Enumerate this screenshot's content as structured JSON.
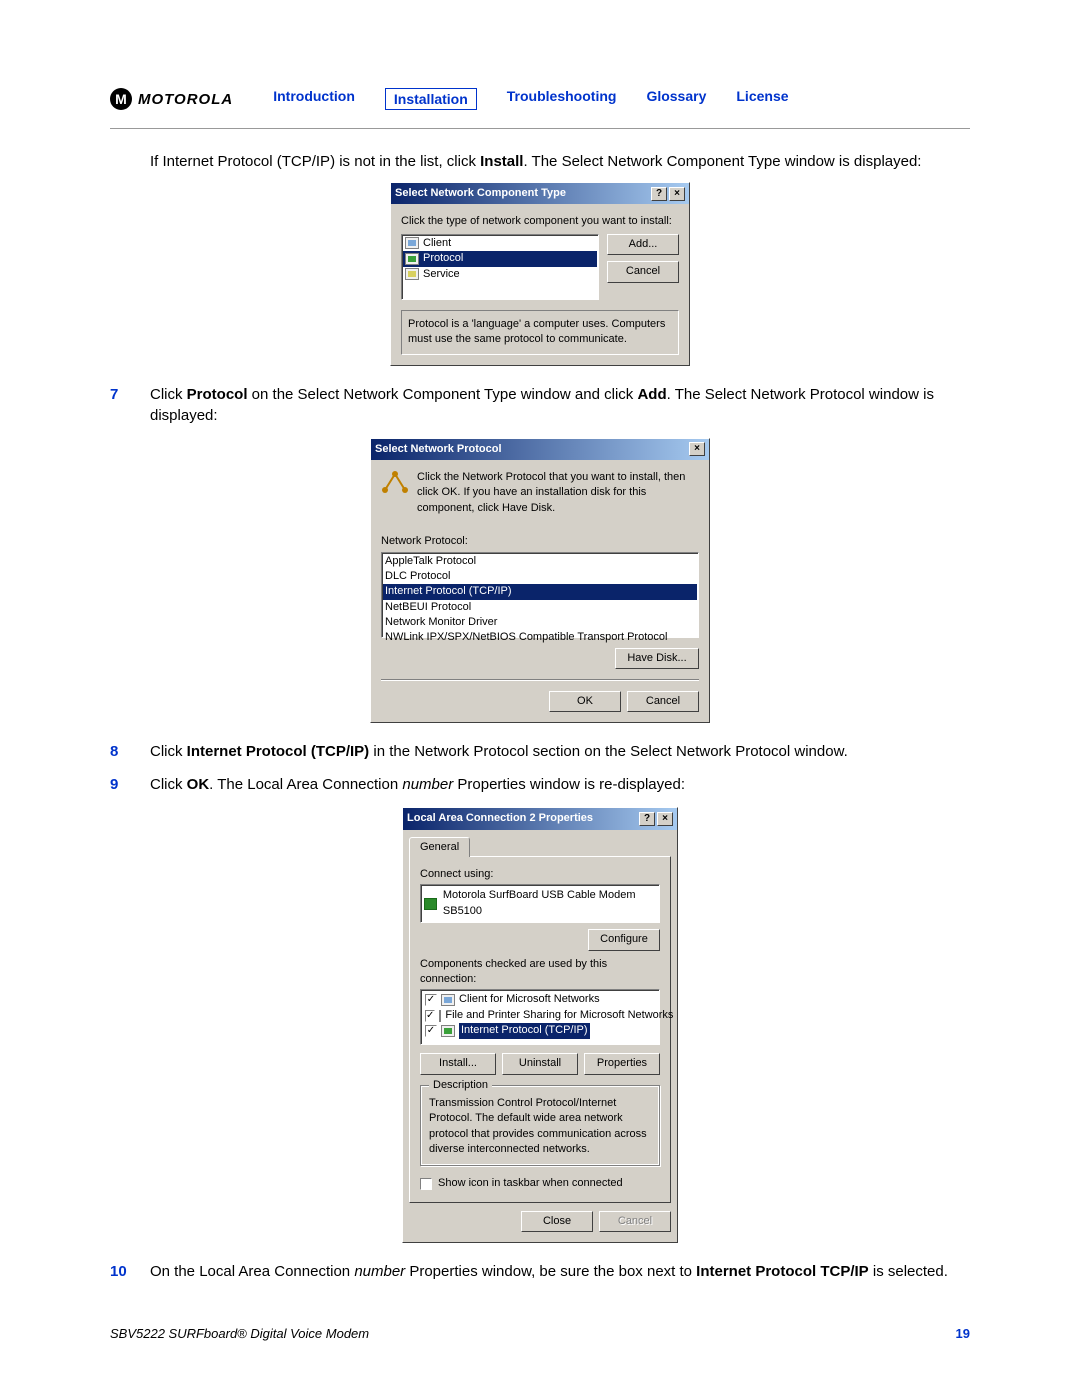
{
  "header": {
    "brand": "MOTOROLA",
    "nav": {
      "introduction": "Introduction",
      "installation": "Installation",
      "troubleshooting": "Troubleshooting",
      "glossary": "Glossary",
      "license": "License"
    }
  },
  "intro": {
    "pre": "If Internet Protocol (TCP/IP) is not in the list, click ",
    "bold": "Install",
    "post": ". The Select Network Component Type window is displayed:"
  },
  "dlg1": {
    "title": "Select Network Component Type",
    "instruction": "Click the type of network component you want to install:",
    "items": {
      "client": "Client",
      "protocol": "Protocol",
      "service": "Service"
    },
    "buttons": {
      "add": "Add...",
      "cancel": "Cancel"
    },
    "desc": "Protocol is a 'language' a computer uses. Computers must use the same protocol to communicate."
  },
  "step7": {
    "num": "7",
    "a": "Click ",
    "b": "Protocol",
    "c": " on the Select Network Component Type window and click ",
    "d": "Add",
    "e": ". The Select Network Protocol window is displayed:"
  },
  "dlg2": {
    "title": "Select Network Protocol",
    "instruction": "Click the Network Protocol that you want to install, then click OK. If you have an installation disk for this component, click Have Disk.",
    "list_label": "Network Protocol:",
    "items": {
      "appletalk": "AppleTalk Protocol",
      "dlc": "DLC Protocol",
      "tcpip": "Internet Protocol (TCP/IP)",
      "netbeui": "NetBEUI Protocol",
      "monitor": "Network Monitor Driver",
      "nwlink": "NWLink IPX/SPX/NetBIOS Compatible Transport Protocol"
    },
    "buttons": {
      "havedisk": "Have Disk...",
      "ok": "OK",
      "cancel": "Cancel"
    }
  },
  "step8": {
    "num": "8",
    "a": "Click ",
    "b": "Internet Protocol (TCP/IP)",
    "c": " in the Network Protocol section on the Select Network Protocol window."
  },
  "step9": {
    "num": "9",
    "a": "Click ",
    "b": "OK",
    "c": ". The Local Area Connection ",
    "d": "number",
    "e": " Properties window is re-displayed:"
  },
  "dlg3": {
    "title": "Local Area Connection 2 Properties",
    "tab": "General",
    "connect_label": "Connect using:",
    "adapter": "Motorola SurfBoard USB Cable Modem SB5100",
    "configure": "Configure",
    "comp_label": "Components checked are used by this connection:",
    "items": {
      "client": "Client for Microsoft Networks",
      "fps": "File and Printer Sharing for Microsoft Networks",
      "tcpip": "Internet Protocol (TCP/IP)"
    },
    "buttons": {
      "install": "Install...",
      "uninstall": "Uninstall",
      "properties": "Properties"
    },
    "desc_label": "Description",
    "desc": "Transmission Control Protocol/Internet Protocol. The default wide area network protocol that provides communication across diverse interconnected networks.",
    "showicon": "Show icon in taskbar when connected",
    "close": "Close",
    "cancel": "Cancel"
  },
  "step10": {
    "num": "10",
    "a": "On the Local Area Connection ",
    "b": "number",
    "c": " Properties window, be sure the box next to ",
    "d": "Internet Protocol TCP/IP",
    "e": " is selected."
  },
  "footer": {
    "left": "SBV5222 SURFboard® Digital Voice Modem",
    "page": "19"
  }
}
